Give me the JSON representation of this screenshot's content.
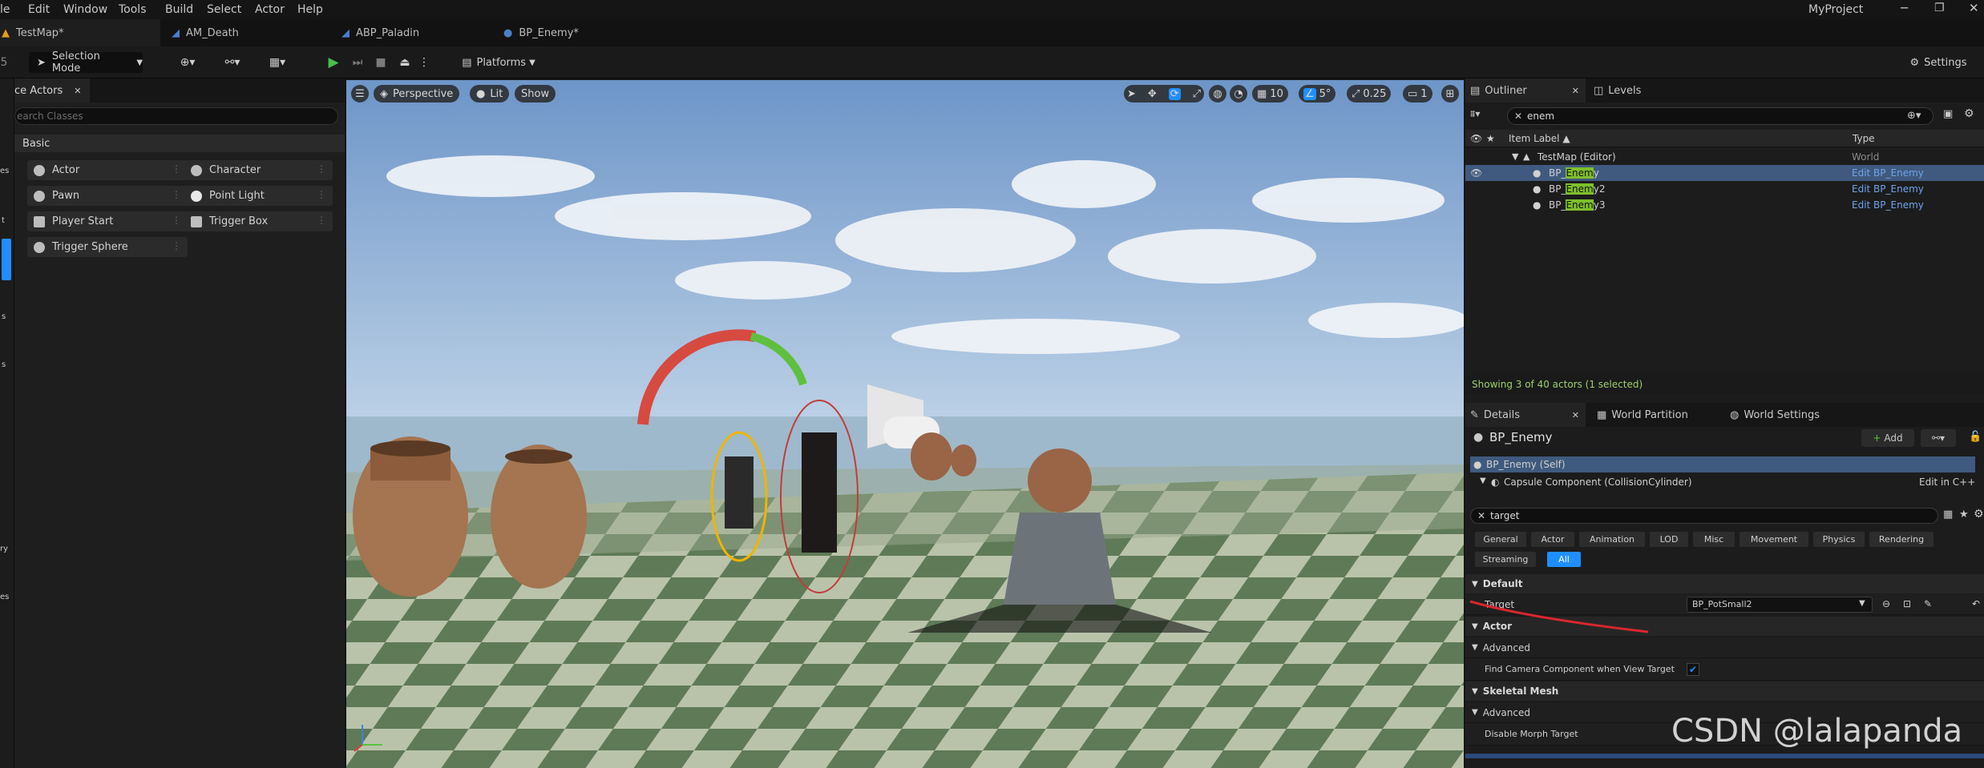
{
  "menubar": {
    "items": [
      "le",
      "Edit",
      "Window",
      "Tools",
      "Build",
      "Select",
      "Actor",
      "Help"
    ],
    "project": "MyProject"
  },
  "tabs": [
    {
      "label": "TestMap*"
    },
    {
      "label": "AM_Death"
    },
    {
      "label": "ABP_Paladin"
    },
    {
      "label": "BP_Enemy*"
    }
  ],
  "toolbar": {
    "selection_mode": "Selection Mode",
    "platforms": "Platforms",
    "settings": "Settings"
  },
  "place_actors": {
    "title": "ce Actors",
    "search_placeholder": "earch Classes",
    "section": "Basic",
    "items": [
      "Actor",
      "Character",
      "Pawn",
      "Point Light",
      "Player Start",
      "Trigger Box",
      "Trigger Sphere"
    ],
    "strip_letters": [
      "es",
      "t",
      "s",
      "s",
      "ry",
      "es"
    ]
  },
  "viewport": {
    "perspective": "Perspective",
    "lit": "Lit",
    "show": "Show",
    "grid_size": "10",
    "rot_snap": "5°",
    "scale_snap": "0.25",
    "camera_speed": "1"
  },
  "outliner": {
    "tab": "Outliner",
    "levels_tab": "Levels",
    "search": "enem",
    "col_label": "Item Label",
    "col_type": "Type",
    "rows": [
      {
        "pre": "TestMap (Editor)",
        "match": "",
        "post": "",
        "type": "World"
      },
      {
        "pre": "BP_",
        "match": "Enem",
        "post": "y",
        "type": "Edit BP_Enemy"
      },
      {
        "pre": "BP_",
        "match": "Enem",
        "post": "y2",
        "type": "Edit BP_Enemy"
      },
      {
        "pre": "BP_",
        "match": "Enem",
        "post": "y3",
        "type": "Edit BP_Enemy"
      }
    ],
    "status": "Showing 3 of 40 actors (1 selected)"
  },
  "details": {
    "tab": "Details",
    "tab2": "World Partition",
    "tab3": "World Settings",
    "object_name": "BP_Enemy",
    "add_label": "Add",
    "self_row": "BP_Enemy (Self)",
    "component_row": "Capsule Component (CollisionCylinder)",
    "edit_cpp": "Edit in C++",
    "search": "target",
    "categories": [
      "General",
      "Actor",
      "Animation",
      "LOD",
      "Misc",
      "Movement",
      "Physics",
      "Rendering",
      "Streaming",
      "All"
    ],
    "sec_default": "Default",
    "prop_target": "Target",
    "target_value": "BP_PotSmall2",
    "sec_actor": "Actor",
    "advanced": "Advanced",
    "prop_find_camera": "Find Camera Component when View Target",
    "sec_skeletal": "Skeletal Mesh",
    "advanced2": "Advanced",
    "prop_morph": "Disable Morph Target"
  },
  "watermark": "CSDN @lalapanda",
  "colors": {
    "accent": "#1f8fff",
    "match": "#7fbf2a",
    "link": "#6fa3ea",
    "annotation": "#d9262e"
  }
}
